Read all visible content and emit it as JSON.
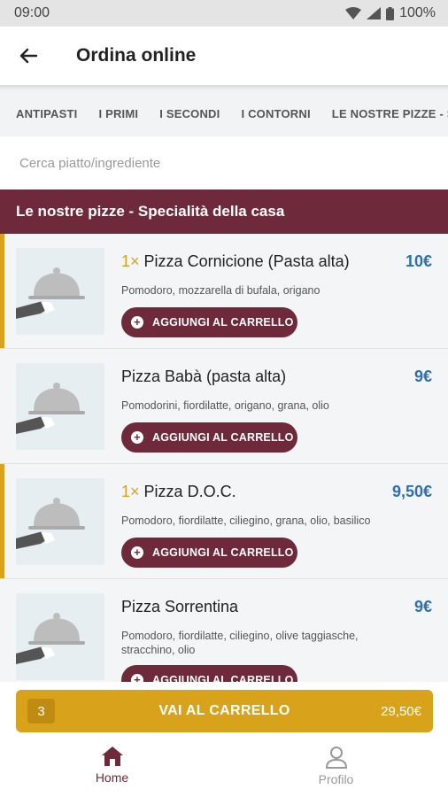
{
  "status_bar": {
    "time": "09:00",
    "battery": "100%"
  },
  "app_bar": {
    "title": "Ordina online"
  },
  "categories": [
    "ANTIPASTI",
    "I PRIMI",
    "I SECONDI",
    "I CONTORNI",
    "LE NOSTRE PIZZE - SPECIALITÀ DELLA CASA"
  ],
  "search": {
    "placeholder": "Cerca piatto/ingrediente"
  },
  "section": {
    "title": "Le nostre pizze - Specialità della casa"
  },
  "items": [
    {
      "qty": "1×",
      "name": "Pizza Cornicione (Pasta alta)",
      "price": "10€",
      "desc": "Pomodoro, mozzarella di bufala, origano",
      "button": "AGGIUNGI AL CARRELLO",
      "selected": true
    },
    {
      "qty": "",
      "name": "Pizza Babà (pasta alta)",
      "price": "9€",
      "desc": "Pomodorini, fiordilatte, origano, grana, olio",
      "button": "AGGIUNGI AL CARRELLO",
      "selected": false
    },
    {
      "qty": "1×",
      "name": "Pizza D.O.C.",
      "price": "9,50€",
      "desc": "Pomodoro, fiordilatte, ciliegino, grana, olio, basilico",
      "button": "AGGIUNGI AL CARRELLO",
      "selected": true
    },
    {
      "qty": "",
      "name": "Pizza Sorrentina",
      "price": "9€",
      "desc": "Pomodoro, fiordilatte, ciliegino, olive taggiasche, stracchino, olio",
      "button": "AGGIUNGI AL CARRELLO",
      "selected": false
    }
  ],
  "cart": {
    "count": "3",
    "label": "VAI AL CARRELLO",
    "total": "29,50€"
  },
  "nav": {
    "home": "Home",
    "profile": "Profilo"
  },
  "colors": {
    "brand": "#6e2a3a",
    "accent": "#d9a21b",
    "price": "#2c6fb5"
  }
}
